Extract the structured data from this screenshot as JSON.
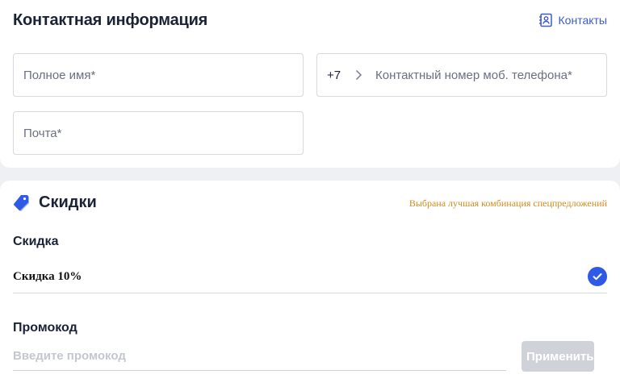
{
  "contact": {
    "title": "Контактная информация",
    "contacts_link": "Контакты",
    "name_placeholder": "Полное имя",
    "phone_prefix": "+7",
    "phone_placeholder": "Контактный номер моб. телефона",
    "email_placeholder": "Почта",
    "required_mark": "*"
  },
  "discounts": {
    "title": "Скидки",
    "best_combo_note": "Выбрана лучшая комбинация спецпредложений",
    "discount_label": "Скидка",
    "selected_discount": "Скидка 10%",
    "promo_label": "Промокод",
    "promo_placeholder": "Введите промокод",
    "apply_button": "Применить"
  },
  "colors": {
    "accent": "#3c5bcf",
    "check": "#2f5ae8",
    "note": "#d28b1e",
    "required": "#d3232f"
  },
  "icons": {
    "contacts": "address-book-icon",
    "discount": "tag-icon",
    "check": "check-circle-icon",
    "chevron": "chevron-right-icon"
  }
}
